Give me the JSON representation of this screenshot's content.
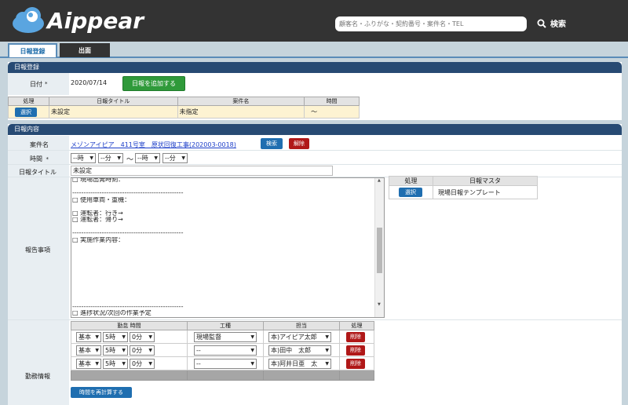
{
  "header": {
    "logo_text": "Aippear",
    "search_placeholder": "顧客名・ふりがな・契約番号・案件名・TEL",
    "search_label": "検索"
  },
  "tabs": [
    {
      "label": "日報登録",
      "active": true
    },
    {
      "label": "出面",
      "active": false
    }
  ],
  "registration": {
    "title": "日報登録",
    "date_label": "日付",
    "required_mark": "*",
    "date_value": "2020/07/14",
    "add_button": "日報を追加する",
    "table_headers": [
      "処理",
      "日報タイトル",
      "案件名",
      "時間"
    ],
    "row": {
      "action": "選択",
      "title": "未設定",
      "project": "未指定",
      "time": "〜"
    }
  },
  "content": {
    "title": "日報内容",
    "project_label": "案件名",
    "project_link": "メゾンアイピア　411号室　原状回復工事(202003-0018)",
    "search_button": "検索",
    "clear_button": "解除",
    "time_label": "時間",
    "time_from_hour": "--時",
    "time_from_min": "--分",
    "time_sep": "〜",
    "time_to_hour": "--時",
    "time_to_min": "--分",
    "title_label": "日報タイトル",
    "title_value": "未設定",
    "report_label": "報告事項",
    "report_lines": [
      "□ 現場出発時刻：",
      "",
      "-------------------------------------------------",
      "□ 使用車両・重機：",
      "",
      "□ 運転者：行き→",
      "□ 運転者：帰り→",
      "",
      "-------------------------------------------------",
      "□ 実施作業内容：",
      "",
      "",
      "",
      "",
      "",
      "",
      "",
      "",
      "",
      "-------------------------------------------------",
      "□ 進捗状況/次回の作業予定"
    ],
    "master_table": {
      "headers": [
        "処理",
        "日報マスタ"
      ],
      "rows": [
        {
          "action": "選択",
          "name": "現場日報テンプレート"
        }
      ]
    },
    "work_label": "勤務情報",
    "work_headers": [
      "勤怠 時間",
      "工種",
      "担当",
      "処理"
    ],
    "work_rows": [
      {
        "type": "基本",
        "hour": "5時",
        "min": "0分",
        "kind": "現場監督",
        "staff": "本)アイピア太郎",
        "action": "削除"
      },
      {
        "type": "基本",
        "hour": "5時",
        "min": "0分",
        "kind": "--",
        "staff": "本)田中　太郎",
        "action": "削除"
      },
      {
        "type": "基本",
        "hour": "5時",
        "min": "0分",
        "kind": "--",
        "staff": "本)阿井日亜　太",
        "action": "削除"
      }
    ],
    "recalc_button": "時間を再計算する"
  },
  "colors": {
    "header_bg": "#333333",
    "panel_head": "#274a73",
    "green": "#2f9a3a",
    "blue": "#1f6eb0",
    "red": "#b01818",
    "highlight_row": "#fdf3d2"
  }
}
